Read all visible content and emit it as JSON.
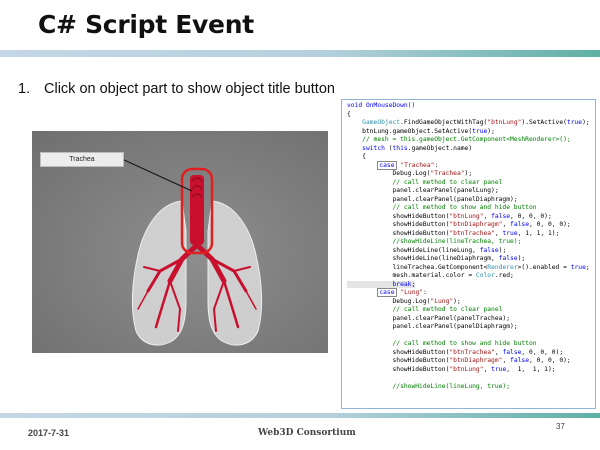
{
  "slide": {
    "title": "C# Script Event",
    "bullet_number": "1.",
    "bullet_text": "Click on object part to show object title button"
  },
  "viewer": {
    "label_button": "Trachea"
  },
  "code_lines": [
    [
      [
        "void OnMouseDown()",
        "kw"
      ]
    ],
    [
      [
        "{",
        ""
      ]
    ],
    [
      [
        "    ",
        ""
      ],
      [
        "GameObject",
        "ty"
      ],
      [
        ".FindGameObjectWithTag(",
        ""
      ],
      [
        "\"btnLung\"",
        "st"
      ],
      [
        ").SetActive(",
        ""
      ],
      [
        "true",
        "kw"
      ],
      [
        ");",
        ""
      ]
    ],
    [
      [
        "    btnLung.gameObject.SetActive(",
        ""
      ],
      [
        "true",
        "kw"
      ],
      [
        ");",
        ""
      ]
    ],
    [
      [
        "    // mesh = this.gameObject.GetComponent<MeshRenderer>();",
        "cm"
      ]
    ],
    [
      [
        "    ",
        ""
      ],
      [
        "switch",
        "kw"
      ],
      [
        " (",
        ""
      ],
      [
        "this",
        "kw"
      ],
      [
        ".gameObject.name)",
        ""
      ]
    ],
    [
      [
        "    {",
        ""
      ]
    ],
    [
      [
        "        ",
        ""
      ],
      [
        "case",
        "kw boxed"
      ],
      [
        " ",
        ""
      ],
      [
        "\"Trachea\"",
        "st"
      ],
      [
        ":",
        ""
      ]
    ],
    [
      [
        "            Debug.Log(",
        ""
      ],
      [
        "\"Trachea\"",
        "st"
      ],
      [
        ");",
        ""
      ]
    ],
    [
      [
        "            // call method to clear panel",
        "cm"
      ]
    ],
    [
      [
        "            panel.clearPanel(panelLung);",
        ""
      ]
    ],
    [
      [
        "            panel.clearPanel(panelDiaphragm);",
        ""
      ]
    ],
    [
      [
        "            // call method to show and hide button",
        "cm"
      ]
    ],
    [
      [
        "            showHideButton(",
        ""
      ],
      [
        "\"btnLung\"",
        "st"
      ],
      [
        ", ",
        ""
      ],
      [
        "false",
        "kw"
      ],
      [
        ", 0, 0, 0);",
        ""
      ]
    ],
    [
      [
        "            showHideButton(",
        ""
      ],
      [
        "\"btnDiaphragm\"",
        "st"
      ],
      [
        ", ",
        ""
      ],
      [
        "false",
        "kw"
      ],
      [
        ", 0, 0, 0);",
        ""
      ]
    ],
    [
      [
        "            showHideButton(",
        ""
      ],
      [
        "\"btnTrachea\"",
        "st"
      ],
      [
        ", ",
        ""
      ],
      [
        "true",
        "kw"
      ],
      [
        ", 1, 1, 1);",
        ""
      ]
    ],
    [
      [
        "            //showHideLine(lineTrachea, true);",
        "cm"
      ]
    ],
    [
      [
        "            showHideLine(lineLung, ",
        ""
      ],
      [
        "false",
        "kw"
      ],
      [
        ");",
        ""
      ]
    ],
    [
      [
        "            showHideLine(lineDiaphragm, ",
        ""
      ],
      [
        "false",
        "kw"
      ],
      [
        ");",
        ""
      ]
    ],
    [
      [
        "            lineTrachea.GetComponent<",
        ""
      ],
      [
        "Renderer",
        "ty"
      ],
      [
        ">().enabled = ",
        ""
      ],
      [
        "true",
        "kw"
      ],
      [
        ";",
        ""
      ]
    ],
    [
      [
        "            mesh.material.color = ",
        ""
      ],
      [
        "Color",
        "ty"
      ],
      [
        ".red;",
        ""
      ]
    ],
    [
      [
        "            ",
        "hl"
      ],
      [
        "break",
        "kw hl"
      ],
      [
        ";",
        "hl"
      ]
    ],
    [
      [
        "        ",
        ""
      ],
      [
        "case",
        "kw boxed"
      ],
      [
        " ",
        ""
      ],
      [
        "\"Lung\"",
        "st"
      ],
      [
        ":",
        ""
      ]
    ],
    [
      [
        "            Debug.Log(",
        ""
      ],
      [
        "\"Lung\"",
        "st"
      ],
      [
        ");",
        ""
      ]
    ],
    [
      [
        "            // call method to clear panel",
        "cm"
      ]
    ],
    [
      [
        "            panel.clearPanel(panelTrachea);",
        ""
      ]
    ],
    [
      [
        "            panel.clearPanel(panelDiaphragm);",
        ""
      ]
    ],
    [
      [
        "",
        ""
      ]
    ],
    [
      [
        "            // call method to show and hide button",
        "cm"
      ]
    ],
    [
      [
        "            showHideButton(",
        ""
      ],
      [
        "\"btnTrachea\"",
        "st"
      ],
      [
        ", ",
        ""
      ],
      [
        "false",
        "kw"
      ],
      [
        ", 0, 0, 0);",
        ""
      ]
    ],
    [
      [
        "            showHideButton(",
        ""
      ],
      [
        "\"btnDiaphragm\"",
        "st"
      ],
      [
        ", ",
        ""
      ],
      [
        "false",
        "kw"
      ],
      [
        ", 0, 0, 0);",
        ""
      ]
    ],
    [
      [
        "            showHideButton(",
        ""
      ],
      [
        "\"btnLung\"",
        "st"
      ],
      [
        ", ",
        ""
      ],
      [
        "true",
        "kw"
      ],
      [
        ",  1,  1, 1);",
        ""
      ]
    ],
    [
      [
        "",
        ""
      ]
    ],
    [
      [
        "            //showHideLine(lineLung, true);",
        "cm"
      ]
    ]
  ],
  "footer": {
    "date": "2017-7-31",
    "organization": "Web3D Consortium",
    "page_number": "37"
  },
  "colors": {
    "accent_bar": "#5fb0a4",
    "highlight_outline": "#e02020",
    "trachea": "#c8102e"
  },
  "icons": [
    "lungs-3d-model-image"
  ]
}
